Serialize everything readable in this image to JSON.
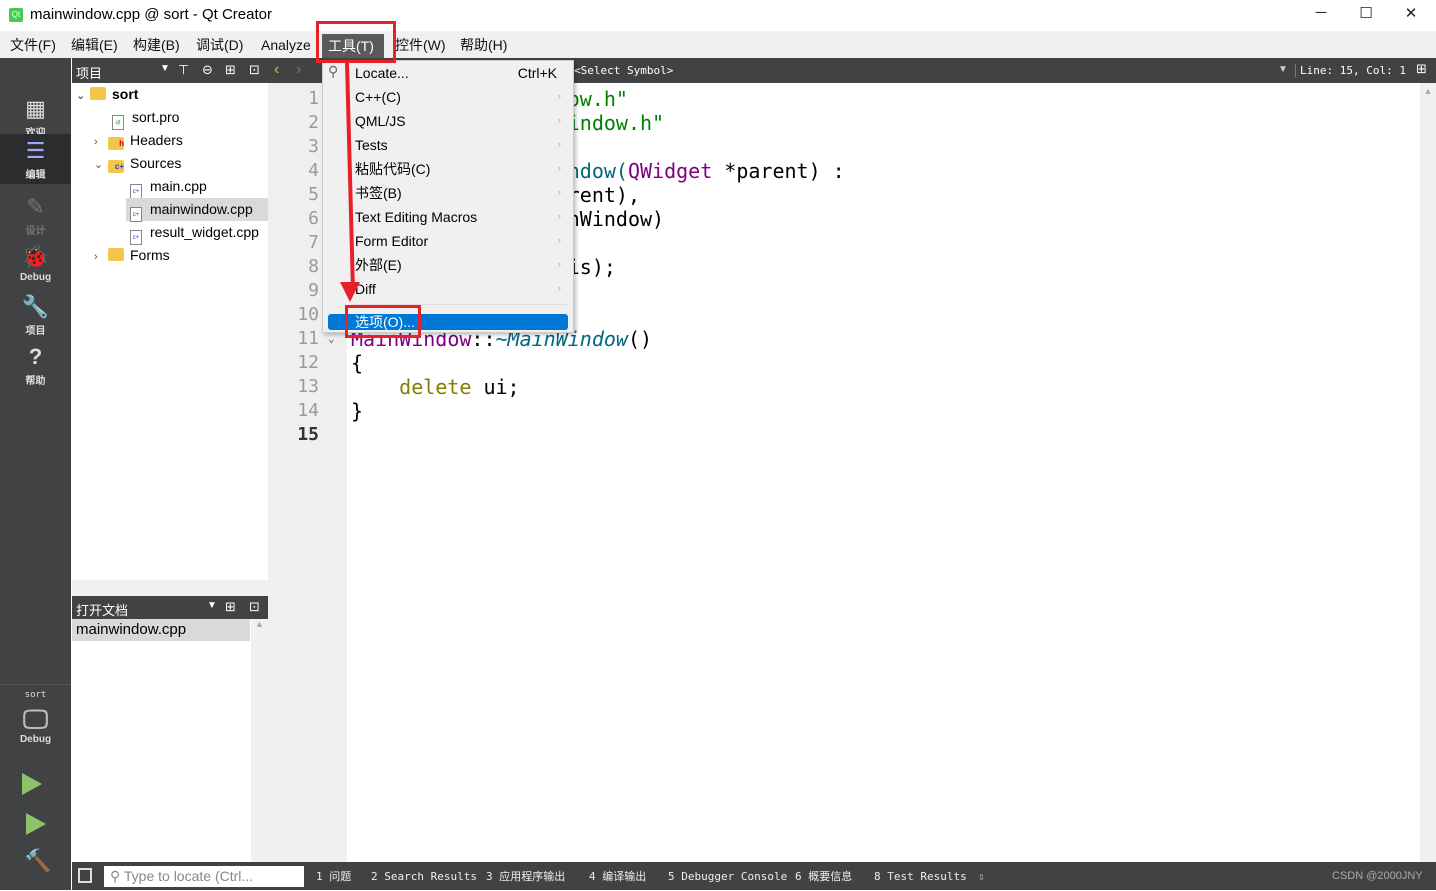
{
  "window": {
    "title": "mainwindow.cpp @ sort - Qt Creator",
    "minimize": "─",
    "maximize": "☐",
    "close": "✕",
    "logo": "Qt"
  },
  "menubar": [
    "文件(F)",
    "编辑(E)",
    "构建(B)",
    "调试(D)",
    "Analyze",
    "工具(T)",
    "控件(W)",
    "帮助(H)"
  ],
  "modes": [
    {
      "label": "欢迎",
      "icon": "▦"
    },
    {
      "label": "编辑",
      "icon": "☰"
    },
    {
      "label": "设计",
      "icon": "✎"
    },
    {
      "label": "Debug",
      "icon": "🐞"
    },
    {
      "label": "项目",
      "icon": "🔧"
    },
    {
      "label": "帮助",
      "icon": "?"
    }
  ],
  "kit": {
    "project": "sort",
    "config": "Debug"
  },
  "project_pane": {
    "title": "项目",
    "tree": [
      {
        "label": "sort",
        "level": 0,
        "expanded": true,
        "bold": true,
        "type": "project"
      },
      {
        "label": "sort.pro",
        "level": 1,
        "type": "pro"
      },
      {
        "label": "Headers",
        "level": 1,
        "expanded": false,
        "type": "folder-h"
      },
      {
        "label": "Sources",
        "level": 1,
        "expanded": true,
        "type": "folder-cpp"
      },
      {
        "label": "main.cpp",
        "level": 2,
        "type": "cpp"
      },
      {
        "label": "mainwindow.cpp",
        "level": 2,
        "type": "cpp",
        "selected": true
      },
      {
        "label": "result_widget.cpp",
        "level": 2,
        "type": "cpp"
      },
      {
        "label": "Forms",
        "level": 1,
        "expanded": false,
        "type": "folder-ui"
      }
    ]
  },
  "open_docs": {
    "title": "打开文档",
    "items": [
      "mainwindow.cpp"
    ]
  },
  "editor": {
    "symbol": "<Select Symbol>",
    "position": "Line: 15, Col: 1",
    "current_line": 15,
    "lines": [
      [
        {
          "t": "#include ",
          "c": ""
        },
        {
          "t": "\"mainwindow.h\"",
          "c": "str"
        }
      ],
      [
        {
          "t": "#include ",
          "c": ""
        },
        {
          "t": "\"ui_mainwindow.h\"",
          "c": "str"
        }
      ],
      [],
      [
        {
          "t": "MainWindow::MainWindow(",
          "c": "fn"
        },
        {
          "t": "QWidget",
          "c": "typ"
        },
        {
          "t": " *parent) :",
          "c": ""
        }
      ],
      [
        {
          "t": "    QMainWindow(parent),",
          "c": ""
        }
      ],
      [
        {
          "t": "    ui(new Ui::MainWindow)",
          "c": ""
        }
      ],
      [
        {
          "t": "{",
          "c": ""
        }
      ],
      [
        {
          "t": "    ui->setupUi(this);",
          "c": ""
        }
      ],
      [
        {
          "t": "}",
          "c": ""
        }
      ],
      [],
      [
        {
          "t": "MainWindow",
          "c": "typ"
        },
        {
          "t": "::",
          "c": ""
        },
        {
          "t": "~MainWindow",
          "c": "fn it"
        },
        {
          "t": "()",
          "c": ""
        }
      ],
      [
        {
          "t": "{",
          "c": ""
        }
      ],
      [
        {
          "t": "    ",
          "c": ""
        },
        {
          "t": "delete",
          "c": "kw"
        },
        {
          "t": " ui;",
          "c": ""
        }
      ],
      [
        {
          "t": "}",
          "c": ""
        }
      ],
      []
    ]
  },
  "tools_menu": {
    "items": [
      {
        "label": "Locate...",
        "shortcut": "Ctrl+K"
      },
      {
        "label": "C++(C)",
        "submenu": true
      },
      {
        "label": "QML/JS",
        "submenu": true
      },
      {
        "label": "Tests",
        "submenu": true
      },
      {
        "label": "粘贴代码(C)",
        "submenu": true
      },
      {
        "label": "书签(B)",
        "submenu": true
      },
      {
        "label": "Text Editing Macros",
        "submenu": true
      },
      {
        "label": "Form Editor",
        "submenu": true
      },
      {
        "label": "外部(E)",
        "submenu": true
      },
      {
        "label": "Diff",
        "submenu": true
      }
    ],
    "options": "选项(O)..."
  },
  "bottom": {
    "locate_placeholder": "Type to locate (Ctrl...",
    "tabs": [
      "1  问题",
      "2  Search Results",
      "3  应用程序输出",
      "4  编译输出",
      "5  Debugger Console",
      "6  概要信息",
      "8  Test Results"
    ],
    "watermark": "CSDN @2000JNY"
  },
  "colors": {
    "highlight": "#0078d7",
    "annotation": "#e8202a",
    "dark": "#404244"
  }
}
